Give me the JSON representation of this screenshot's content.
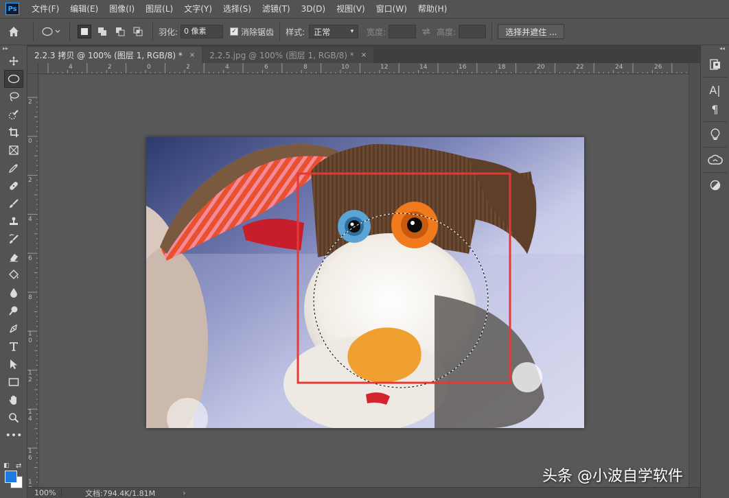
{
  "app": {
    "logo": "Ps"
  },
  "menu": [
    "文件(F)",
    "编辑(E)",
    "图像(I)",
    "图层(L)",
    "文字(Y)",
    "选择(S)",
    "滤镜(T)",
    "3D(D)",
    "视图(V)",
    "窗口(W)",
    "帮助(H)"
  ],
  "options": {
    "feather_label": "羽化:",
    "feather_value": "0 像素",
    "antialias_label": "消除锯齿",
    "antialias_checked": true,
    "style_label": "样式:",
    "style_value": "正常",
    "width_label": "宽度:",
    "height_label": "高度:",
    "select_mask_button": "选择并遮住 ..."
  },
  "tabs": [
    {
      "title": "2.2.3 拷贝 @ 100% (图层 1, RGB/8) *",
      "active": true,
      "close": "×"
    },
    {
      "title": "2.2.5.jpg @ 100% (图层 1, RGB/8) *",
      "active": false,
      "close": "×"
    }
  ],
  "rulers": {
    "horizontal": [
      "4",
      "2",
      "0",
      "2",
      "4",
      "6",
      "8",
      "10",
      "12",
      "14",
      "16",
      "18",
      "20",
      "22",
      "24",
      "26"
    ],
    "vertical": [
      "2",
      "0",
      "2",
      "4",
      "6",
      "8",
      "10",
      "12",
      "14",
      "16",
      "18"
    ]
  },
  "status": {
    "zoom": "100%",
    "doc_info": "文档:794.4K/1.81M",
    "arrow": "›"
  },
  "tools": [
    "move-icon",
    "elliptical-marquee-icon",
    "lasso-icon",
    "quick-selection-icon",
    "crop-icon",
    "frame-icon",
    "eyedropper-icon",
    "healing-brush-icon",
    "brush-icon",
    "clone-stamp-icon",
    "history-brush-icon",
    "eraser-icon",
    "paint-bucket-icon",
    "blur-icon",
    "dodge-icon",
    "pen-icon",
    "type-icon",
    "path-selection-icon",
    "rectangle-icon",
    "hand-icon",
    "zoom-icon",
    "more-tools-icon"
  ],
  "colors": {
    "foreground": "#1e7be0",
    "background": "#ffffff",
    "selection_rect": "#e53935"
  },
  "watermark": "头条 @小波自学软件"
}
